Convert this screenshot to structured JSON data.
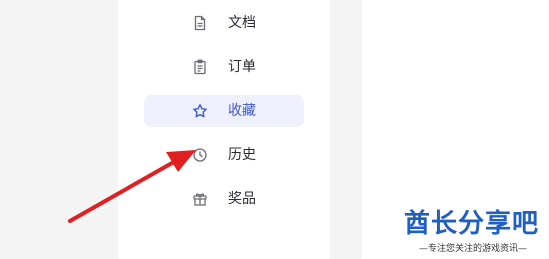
{
  "menu": {
    "items": [
      {
        "label": "文档",
        "icon": "document-icon",
        "active": false
      },
      {
        "label": "订单",
        "icon": "order-clipboard-icon",
        "active": false
      },
      {
        "label": "收藏",
        "icon": "star-icon",
        "active": true
      },
      {
        "label": "历史",
        "icon": "clock-history-icon",
        "active": false
      },
      {
        "label": "奖品",
        "icon": "gift-icon",
        "active": false
      }
    ]
  },
  "watermark": {
    "title": "酋长分享吧",
    "subtitle": "—专注您关注的游戏资讯—"
  },
  "colors": {
    "accent": "#3d57d8",
    "active_bg": "#eef1fd",
    "annotation_arrow": "#e02020",
    "watermark": "#1f5fc0"
  }
}
